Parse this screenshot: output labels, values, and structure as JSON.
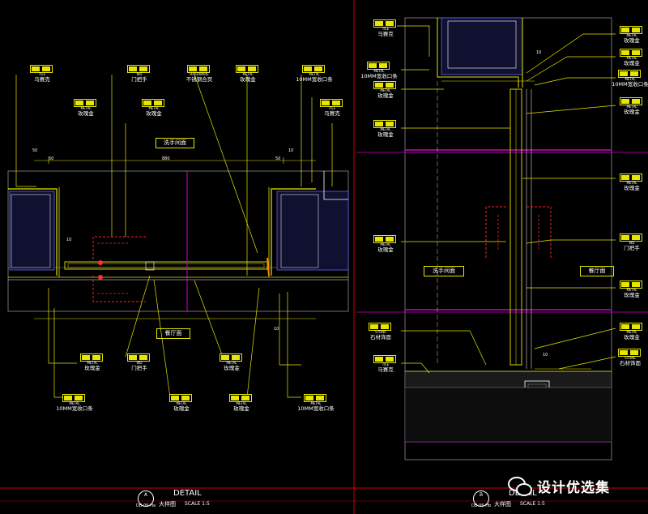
{
  "title_block": {
    "left": {
      "sheet_id": "DB-06-Ha",
      "number": "A",
      "detail": "DETAIL",
      "name": "大样图",
      "scale": "SCALE 1:5"
    },
    "right": {
      "sheet_id": "DB-06-Hb",
      "number": "B",
      "detail": "DETAIL",
      "name": "大样图",
      "scale": "SCALE 1:5"
    }
  },
  "room_labels": {
    "left_top": "洗手间面",
    "left_bottom": "餐厅面",
    "right_left": "洗手间面",
    "right_right": "餐厅面"
  },
  "tags_left_top": [
    {
      "code": "TILE",
      "desc": "马赛克"
    },
    {
      "code": "WD",
      "desc": "门把手"
    },
    {
      "code": "HARDWARE",
      "desc": "不锈钢合页"
    },
    {
      "code": "METAL",
      "desc": "玫瑰金"
    },
    {
      "code": "METAL",
      "desc": "10MM宽收口条"
    },
    {
      "code": "METAL",
      "desc": "玫瑰金"
    },
    {
      "code": "METAL",
      "desc": "玫瑰金"
    },
    {
      "code": "TILE",
      "desc": "马赛克"
    }
  ],
  "tags_left_bottom": [
    {
      "code": "METAL",
      "desc": "玫瑰金"
    },
    {
      "code": "WD",
      "desc": "门把手"
    },
    {
      "code": "METAL",
      "desc": "玫瑰金"
    },
    {
      "code": "METAL",
      "desc": "10MM宽收口条"
    },
    {
      "code": "METAL",
      "desc": "玫瑰金"
    },
    {
      "code": "METAL",
      "desc": "玫瑰金"
    },
    {
      "code": "METAL",
      "desc": "10MM宽收口条"
    }
  ],
  "tags_right_left": [
    {
      "code": "TILE",
      "desc": "马赛克"
    },
    {
      "code": "METAL",
      "desc": "10MM宽收口条"
    },
    {
      "code": "METAL",
      "desc": "玫瑰金"
    },
    {
      "code": "METAL",
      "desc": "玫瑰金"
    },
    {
      "code": "METAL",
      "desc": "玫瑰金"
    },
    {
      "code": "STONE",
      "desc": "石材饰面"
    },
    {
      "code": "TILE",
      "desc": "马赛克"
    }
  ],
  "tags_right_right": [
    {
      "code": "METAL",
      "desc": "玫瑰金"
    },
    {
      "code": "METAL",
      "desc": "玫瑰金"
    },
    {
      "code": "METAL",
      "desc": "10MM宽收口条"
    },
    {
      "code": "METAL",
      "desc": "玫瑰金"
    },
    {
      "code": "METAL",
      "desc": "玫瑰金"
    },
    {
      "code": "WD",
      "desc": "门把手"
    },
    {
      "code": "METAL",
      "desc": "玫瑰金"
    },
    {
      "code": "METAL",
      "desc": "玫瑰金"
    },
    {
      "code": "STONE",
      "desc": "石材饰面"
    }
  ],
  "dims": {
    "d1": "50",
    "d2": "50",
    "d3": "880",
    "d4": "10",
    "d5": "10",
    "d6": "10",
    "d7": "50",
    "d8": "10",
    "d9": "10"
  },
  "watermark": "设计优选集"
}
